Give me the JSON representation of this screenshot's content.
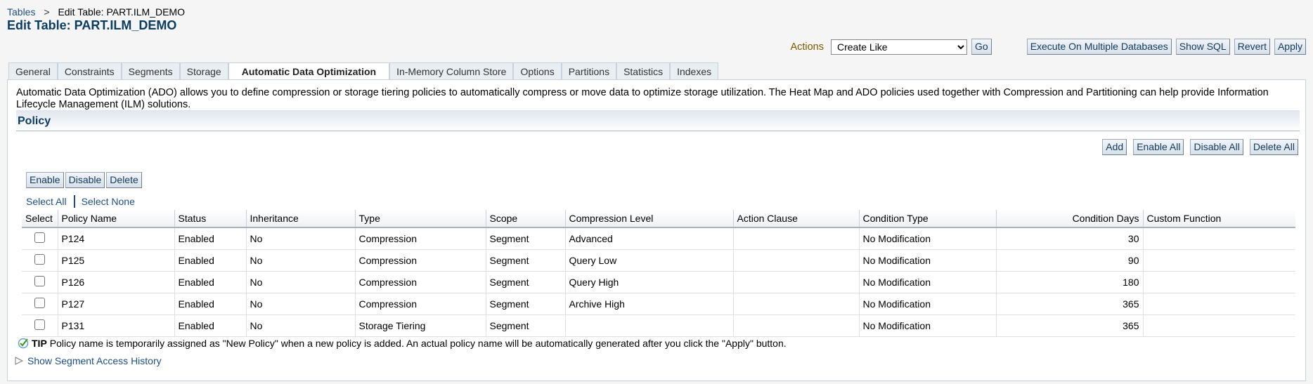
{
  "breadcrumb": {
    "parent": "Tables",
    "separator": ">",
    "current": "Edit Table: PART.ILM_DEMO"
  },
  "page_title": "Edit Table: PART.ILM_DEMO",
  "actions": {
    "label": "Actions",
    "selected": "Create Like",
    "go": "Go",
    "execute_multi": "Execute On Multiple Databases",
    "show_sql": "Show SQL",
    "revert": "Revert",
    "apply": "Apply"
  },
  "tabs": [
    "General",
    "Constraints",
    "Segments",
    "Storage",
    "Automatic Data Optimization",
    "In-Memory Column Store",
    "Options",
    "Partitions",
    "Statistics",
    "Indexes"
  ],
  "active_tab": "Automatic Data Optimization",
  "description": "Automatic Data Optimization (ADO) allows you to define compression or storage tiering policies to automatically compress or move data to optimize storage utilization. The Heat Map and ADO policies used together with Compression and Partitioning can help provide Information Lifecycle Management (ILM) solutions.",
  "policy": {
    "header": "Policy",
    "buttons": {
      "add": "Add",
      "enable_all": "Enable All",
      "disable_all": "Disable All",
      "delete_all": "Delete All"
    },
    "row_buttons": {
      "enable": "Enable",
      "disable": "Disable",
      "delete": "Delete"
    },
    "select_all": "Select All",
    "select_none": "Select None",
    "columns": [
      "Select",
      "Policy Name",
      "Status",
      "Inheritance",
      "Type",
      "Scope",
      "Compression Level",
      "Action Clause",
      "Condition Type",
      "Condition Days",
      "Custom Function"
    ],
    "rows": [
      {
        "name": "P124",
        "status": "Enabled",
        "inheritance": "No",
        "type": "Compression",
        "scope": "Segment",
        "compression": "Advanced",
        "action": "",
        "condition_type": "No Modification",
        "days": "30",
        "custom": ""
      },
      {
        "name": "P125",
        "status": "Enabled",
        "inheritance": "No",
        "type": "Compression",
        "scope": "Segment",
        "compression": "Query Low",
        "action": "",
        "condition_type": "No Modification",
        "days": "90",
        "custom": ""
      },
      {
        "name": "P126",
        "status": "Enabled",
        "inheritance": "No",
        "type": "Compression",
        "scope": "Segment",
        "compression": "Query High",
        "action": "",
        "condition_type": "No Modification",
        "days": "180",
        "custom": ""
      },
      {
        "name": "P127",
        "status": "Enabled",
        "inheritance": "No",
        "type": "Compression",
        "scope": "Segment",
        "compression": "Archive High",
        "action": "",
        "condition_type": "No Modification",
        "days": "365",
        "custom": ""
      },
      {
        "name": "P131",
        "status": "Enabled",
        "inheritance": "No",
        "type": "Storage Tiering",
        "scope": "Segment",
        "compression": "",
        "action": "",
        "condition_type": "No Modification",
        "days": "365",
        "custom": ""
      }
    ],
    "tip_label": "TIP",
    "tip": "Policy name is temporarily assigned as \"New Policy\" when a new policy is added. An actual policy name will be automatically generated after you click the \"Apply\" button.",
    "show_history": "Show Segment Access History"
  }
}
